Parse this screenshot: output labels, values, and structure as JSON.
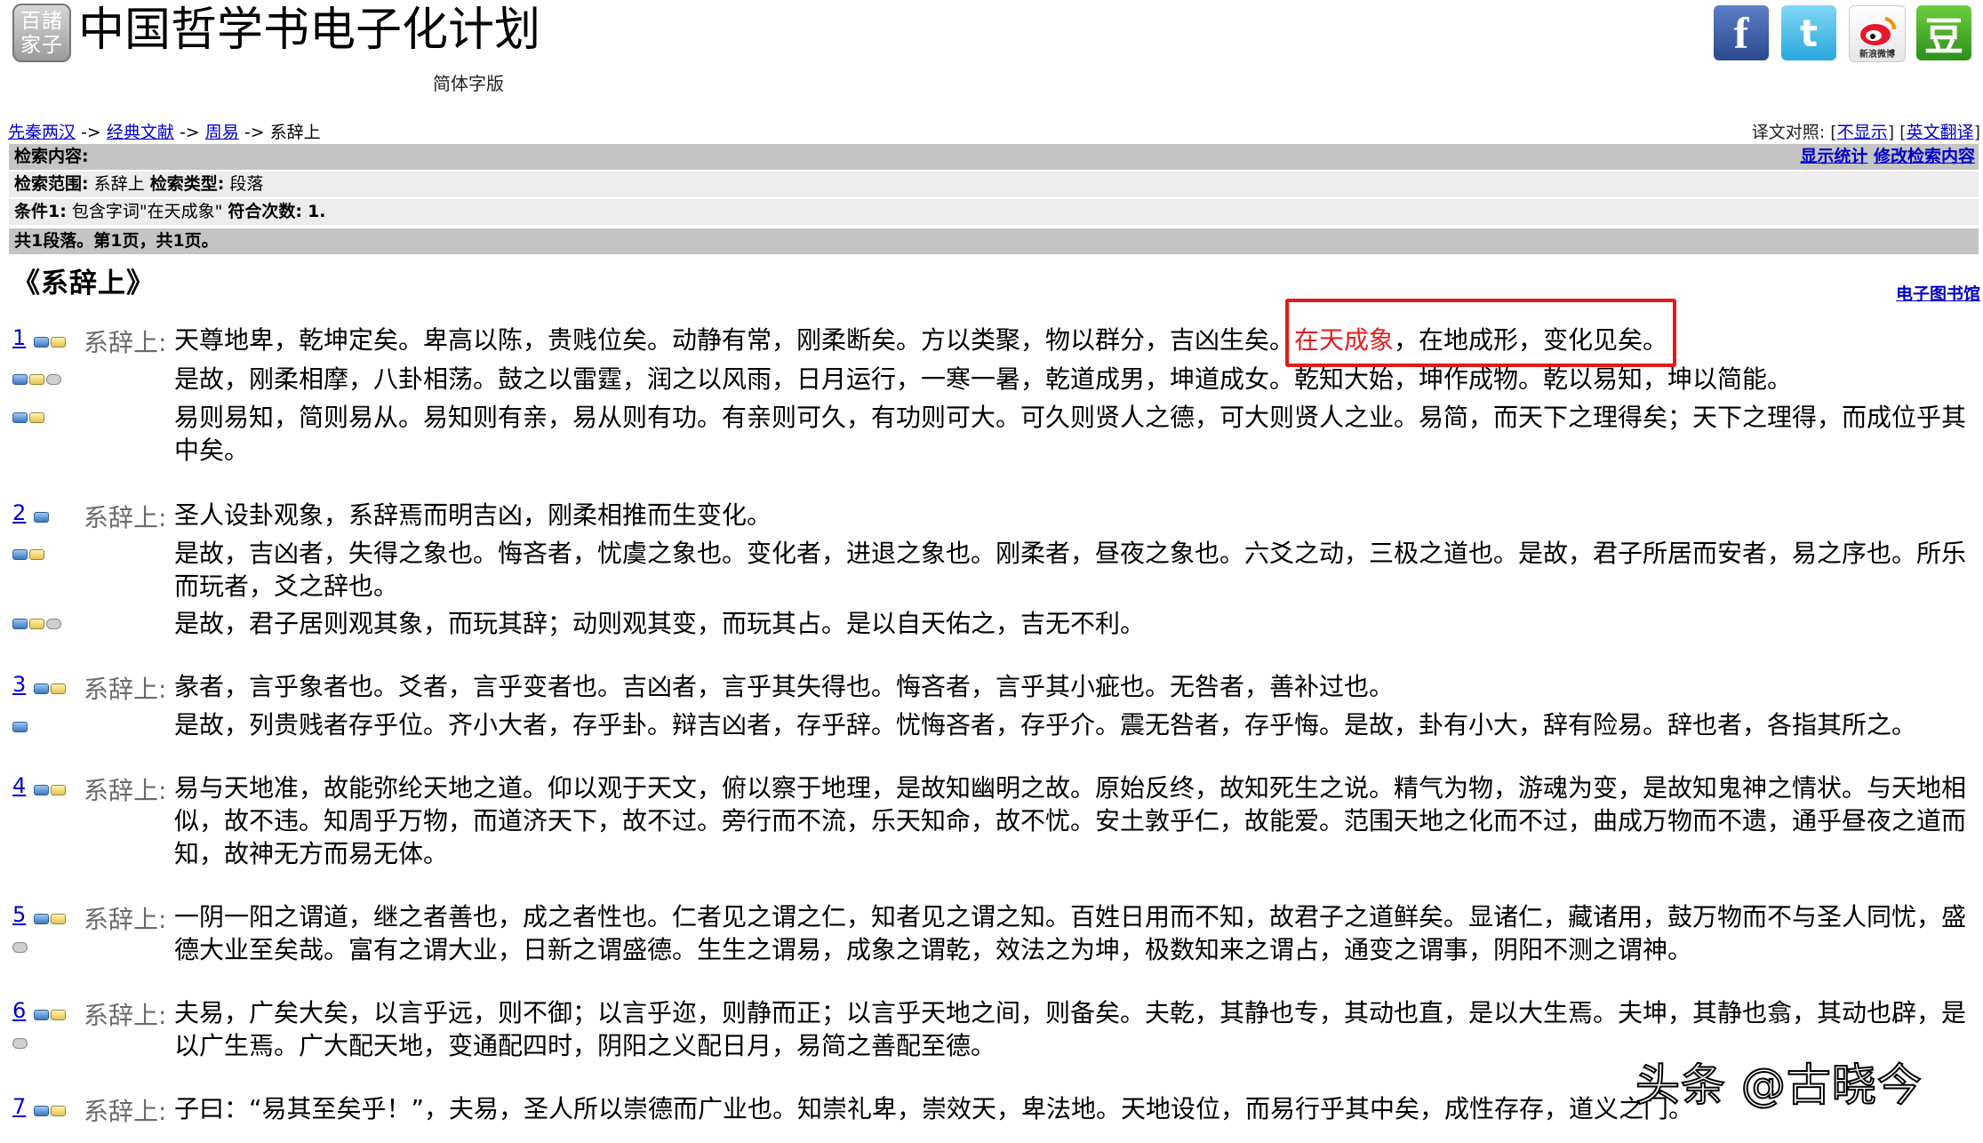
{
  "header": {
    "logo": "百諸家子",
    "title": "中国哲学书电子化计划",
    "edition": "简体字版"
  },
  "social": {
    "facebook": "f",
    "twitter": "t",
    "weibo": "新浪微博",
    "douban": "豆"
  },
  "breadcrumb": [
    {
      "label": "先秦两汉",
      "link": true
    },
    {
      "label": "经典文献",
      "link": true
    },
    {
      "label": "周易",
      "link": true
    },
    {
      "label": "系辞上",
      "link": false
    }
  ],
  "breadcrumb_sep": "->",
  "translation": {
    "prefix": "译文对照: ",
    "option_hide": "不显示",
    "option_english": "英文翻译"
  },
  "search": {
    "content_label": "检索内容:",
    "show_stats": "显示统计",
    "modify_search": "修改检索内容",
    "scope_label": "检索范围:",
    "scope_value": "系辞上",
    "type_label": "检索类型:",
    "type_value": "段落",
    "condition_label": "条件1:",
    "condition_value": "包含字词\"在天成象\"",
    "matches_label": "符合次数:",
    "matches_value": "1.",
    "summary": "共1段落。第1页，共1页。"
  },
  "chapter_title": "《系辞上》",
  "ebook_link": "电子图书馆",
  "passages": [
    {
      "num": "1",
      "label": "系辞上:",
      "lines": [
        {
          "pre": "天尊地卑，乾坤定矣。卑高以陈，贵贱位矣。动静有常，刚柔断矣。方以类聚，物以群分，吉凶生矣。",
          "hl": "在天成象",
          "post": "，在地成形，变化见矣。"
        },
        {
          "text": "是故，刚柔相摩，八卦相荡。鼓之以雷霆，润之以风雨，日月运行，一寒一暑，乾道成男，坤道成女。乾知大始，坤作成物。乾以易知，坤以简能。"
        },
        {
          "text": "易则易知，简则易从。易知则有亲，易从则有功。有亲则可久，有功则可大。可久则贤人之德，可大则贤人之业。易简，而天下之理得矣；天下之理得，而成位乎其中矣。"
        }
      ]
    },
    {
      "num": "2",
      "label": "系辞上:",
      "lines": [
        {
          "text": "圣人设卦观象，系辞焉而明吉凶，刚柔相推而生变化。"
        },
        {
          "text": "是故，吉凶者，失得之象也。悔吝者，忧虞之象也。变化者，进退之象也。刚柔者，昼夜之象也。六爻之动，三极之道也。是故，君子所居而安者，易之序也。所乐而玩者，爻之辞也。"
        },
        {
          "text": "是故，君子居则观其象，而玩其辞；动则观其变，而玩其占。是以自天佑之，吉无不利。"
        }
      ]
    },
    {
      "num": "3",
      "label": "系辞上:",
      "lines": [
        {
          "text": "彖者，言乎象者也。爻者，言乎变者也。吉凶者，言乎其失得也。悔吝者，言乎其小疵也。无咎者，善补过也。"
        },
        {
          "text": "是故，列贵贱者存乎位。齐小大者，存乎卦。辩吉凶者，存乎辞。忧悔吝者，存乎介。震无咎者，存乎悔。是故，卦有小大，辞有险易。辞也者，各指其所之。"
        }
      ]
    },
    {
      "num": "4",
      "label": "系辞上:",
      "lines": [
        {
          "text": "易与天地准，故能弥纶天地之道。仰以观于天文，俯以察于地理，是故知幽明之故。原始反终，故知死生之说。精气为物，游魂为变，是故知鬼神之情状。与天地相似，故不违。知周乎万物，而道济天下，故不过。旁行而不流，乐天知命，故不忧。安土敦乎仁，故能爱。范围天地之化而不过，曲成万物而不遗，通乎昼夜之道而知，故神无方而易无体。"
        }
      ]
    },
    {
      "num": "5",
      "label": "系辞上:",
      "lines": [
        {
          "text": "一阴一阳之谓道，继之者善也，成之者性也。仁者见之谓之仁，知者见之谓之知。百姓日用而不知，故君子之道鲜矣。显诸仁，藏诸用，鼓万物而不与圣人同忧，盛德大业至矣哉。富有之谓大业，日新之谓盛德。生生之谓易，成象之谓乾，效法之为坤，极数知来之谓占，通变之谓事，阴阳不测之谓神。"
        }
      ]
    },
    {
      "num": "6",
      "label": "系辞上:",
      "lines": [
        {
          "text": "夫易，广矣大矣，以言乎远，则不御；以言乎迩，则静而正；以言乎天地之间，则备矣。夫乾，其静也专，其动也直，是以大生焉。夫坤，其静也翕，其动也辟，是以广生焉。广大配天地，变通配四时，阴阳之义配日月，易简之善配至德。"
        }
      ]
    },
    {
      "num": "7",
      "label": "系辞上:",
      "lines": [
        {
          "text": "子曰：“易其至矣乎！”，夫易，圣人所以崇德而广业也。知崇礼卑，崇效天，卑法地。天地设位，而易行乎其中矣，成性存存，道义之门。"
        }
      ]
    }
  ],
  "watermark": "头条 @古晓今"
}
